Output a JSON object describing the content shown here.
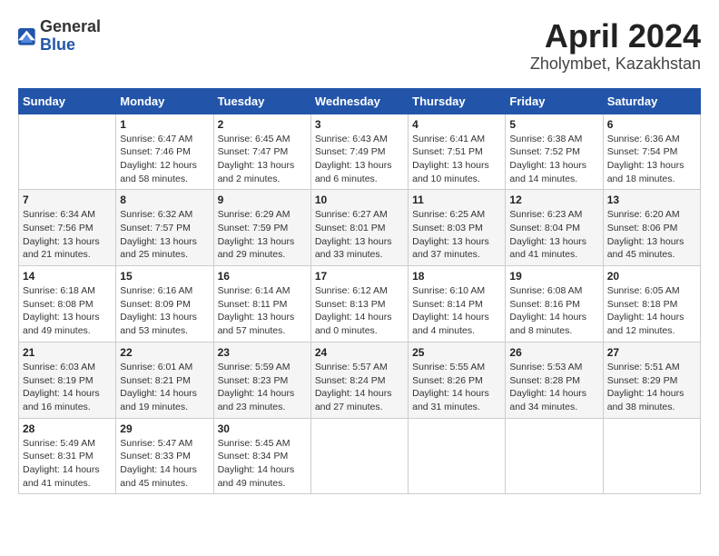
{
  "logo": {
    "general": "General",
    "blue": "Blue"
  },
  "title": "April 2024",
  "subtitle": "Zholymbet, Kazakhstan",
  "days_header": [
    "Sunday",
    "Monday",
    "Tuesday",
    "Wednesday",
    "Thursday",
    "Friday",
    "Saturday"
  ],
  "weeks": [
    [
      {
        "day": "",
        "content": ""
      },
      {
        "day": "1",
        "content": "Sunrise: 6:47 AM\nSunset: 7:46 PM\nDaylight: 12 hours\nand 58 minutes."
      },
      {
        "day": "2",
        "content": "Sunrise: 6:45 AM\nSunset: 7:47 PM\nDaylight: 13 hours\nand 2 minutes."
      },
      {
        "day": "3",
        "content": "Sunrise: 6:43 AM\nSunset: 7:49 PM\nDaylight: 13 hours\nand 6 minutes."
      },
      {
        "day": "4",
        "content": "Sunrise: 6:41 AM\nSunset: 7:51 PM\nDaylight: 13 hours\nand 10 minutes."
      },
      {
        "day": "5",
        "content": "Sunrise: 6:38 AM\nSunset: 7:52 PM\nDaylight: 13 hours\nand 14 minutes."
      },
      {
        "day": "6",
        "content": "Sunrise: 6:36 AM\nSunset: 7:54 PM\nDaylight: 13 hours\nand 18 minutes."
      }
    ],
    [
      {
        "day": "7",
        "content": "Sunrise: 6:34 AM\nSunset: 7:56 PM\nDaylight: 13 hours\nand 21 minutes."
      },
      {
        "day": "8",
        "content": "Sunrise: 6:32 AM\nSunset: 7:57 PM\nDaylight: 13 hours\nand 25 minutes."
      },
      {
        "day": "9",
        "content": "Sunrise: 6:29 AM\nSunset: 7:59 PM\nDaylight: 13 hours\nand 29 minutes."
      },
      {
        "day": "10",
        "content": "Sunrise: 6:27 AM\nSunset: 8:01 PM\nDaylight: 13 hours\nand 33 minutes."
      },
      {
        "day": "11",
        "content": "Sunrise: 6:25 AM\nSunset: 8:03 PM\nDaylight: 13 hours\nand 37 minutes."
      },
      {
        "day": "12",
        "content": "Sunrise: 6:23 AM\nSunset: 8:04 PM\nDaylight: 13 hours\nand 41 minutes."
      },
      {
        "day": "13",
        "content": "Sunrise: 6:20 AM\nSunset: 8:06 PM\nDaylight: 13 hours\nand 45 minutes."
      }
    ],
    [
      {
        "day": "14",
        "content": "Sunrise: 6:18 AM\nSunset: 8:08 PM\nDaylight: 13 hours\nand 49 minutes."
      },
      {
        "day": "15",
        "content": "Sunrise: 6:16 AM\nSunset: 8:09 PM\nDaylight: 13 hours\nand 53 minutes."
      },
      {
        "day": "16",
        "content": "Sunrise: 6:14 AM\nSunset: 8:11 PM\nDaylight: 13 hours\nand 57 minutes."
      },
      {
        "day": "17",
        "content": "Sunrise: 6:12 AM\nSunset: 8:13 PM\nDaylight: 14 hours\nand 0 minutes."
      },
      {
        "day": "18",
        "content": "Sunrise: 6:10 AM\nSunset: 8:14 PM\nDaylight: 14 hours\nand 4 minutes."
      },
      {
        "day": "19",
        "content": "Sunrise: 6:08 AM\nSunset: 8:16 PM\nDaylight: 14 hours\nand 8 minutes."
      },
      {
        "day": "20",
        "content": "Sunrise: 6:05 AM\nSunset: 8:18 PM\nDaylight: 14 hours\nand 12 minutes."
      }
    ],
    [
      {
        "day": "21",
        "content": "Sunrise: 6:03 AM\nSunset: 8:19 PM\nDaylight: 14 hours\nand 16 minutes."
      },
      {
        "day": "22",
        "content": "Sunrise: 6:01 AM\nSunset: 8:21 PM\nDaylight: 14 hours\nand 19 minutes."
      },
      {
        "day": "23",
        "content": "Sunrise: 5:59 AM\nSunset: 8:23 PM\nDaylight: 14 hours\nand 23 minutes."
      },
      {
        "day": "24",
        "content": "Sunrise: 5:57 AM\nSunset: 8:24 PM\nDaylight: 14 hours\nand 27 minutes."
      },
      {
        "day": "25",
        "content": "Sunrise: 5:55 AM\nSunset: 8:26 PM\nDaylight: 14 hours\nand 31 minutes."
      },
      {
        "day": "26",
        "content": "Sunrise: 5:53 AM\nSunset: 8:28 PM\nDaylight: 14 hours\nand 34 minutes."
      },
      {
        "day": "27",
        "content": "Sunrise: 5:51 AM\nSunset: 8:29 PM\nDaylight: 14 hours\nand 38 minutes."
      }
    ],
    [
      {
        "day": "28",
        "content": "Sunrise: 5:49 AM\nSunset: 8:31 PM\nDaylight: 14 hours\nand 41 minutes."
      },
      {
        "day": "29",
        "content": "Sunrise: 5:47 AM\nSunset: 8:33 PM\nDaylight: 14 hours\nand 45 minutes."
      },
      {
        "day": "30",
        "content": "Sunrise: 5:45 AM\nSunset: 8:34 PM\nDaylight: 14 hours\nand 49 minutes."
      },
      {
        "day": "",
        "content": ""
      },
      {
        "day": "",
        "content": ""
      },
      {
        "day": "",
        "content": ""
      },
      {
        "day": "",
        "content": ""
      }
    ]
  ]
}
